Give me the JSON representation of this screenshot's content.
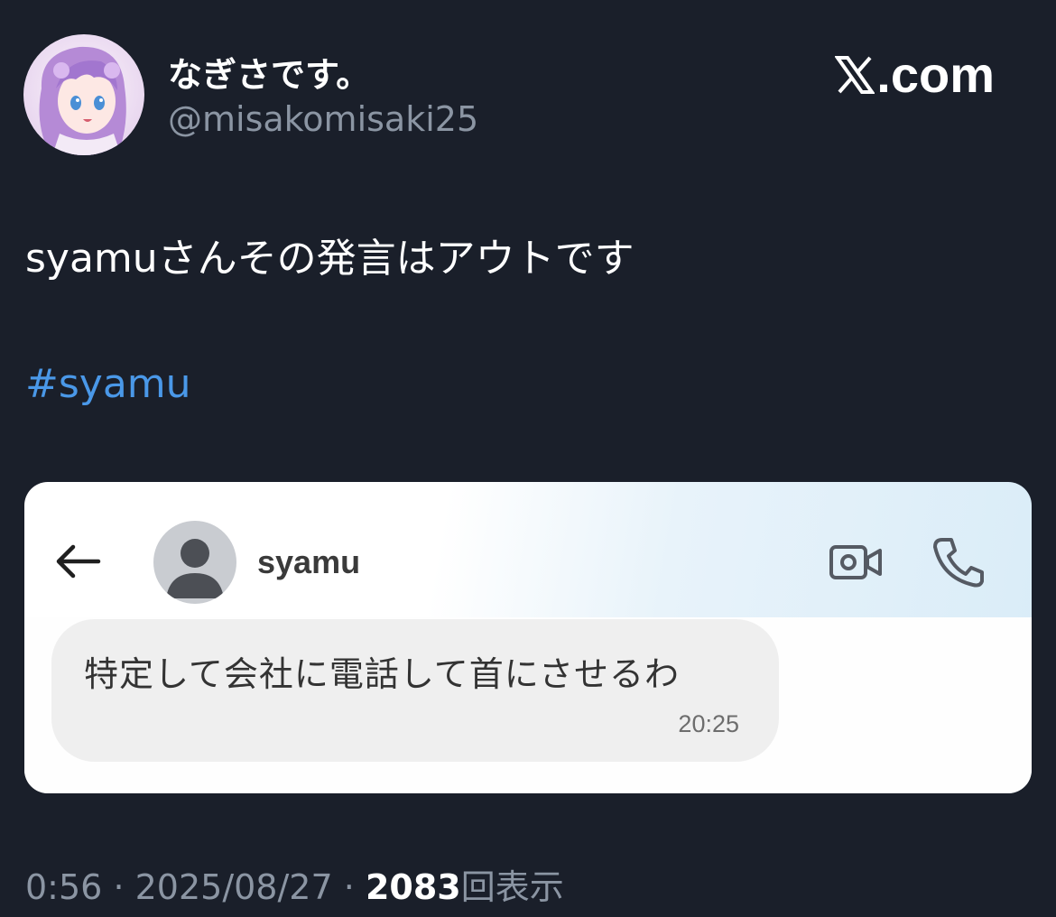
{
  "tweet": {
    "author": {
      "display_name": "なぎさです。",
      "handle": "@misakomisaki25"
    },
    "brand": "X.com",
    "text": "syamuさんその発言はアウトです",
    "hashtag": "#syamu",
    "time": "0:56",
    "separator": "·",
    "date": "2025/08/27",
    "views_count": "2083",
    "views_label": "回表示",
    "link_color": "#4a98e8"
  },
  "media": {
    "chat_header": {
      "contact_name": "syamu"
    },
    "message": {
      "text": "特定して会社に電話して首にさせるわ",
      "time": "20:25"
    }
  }
}
